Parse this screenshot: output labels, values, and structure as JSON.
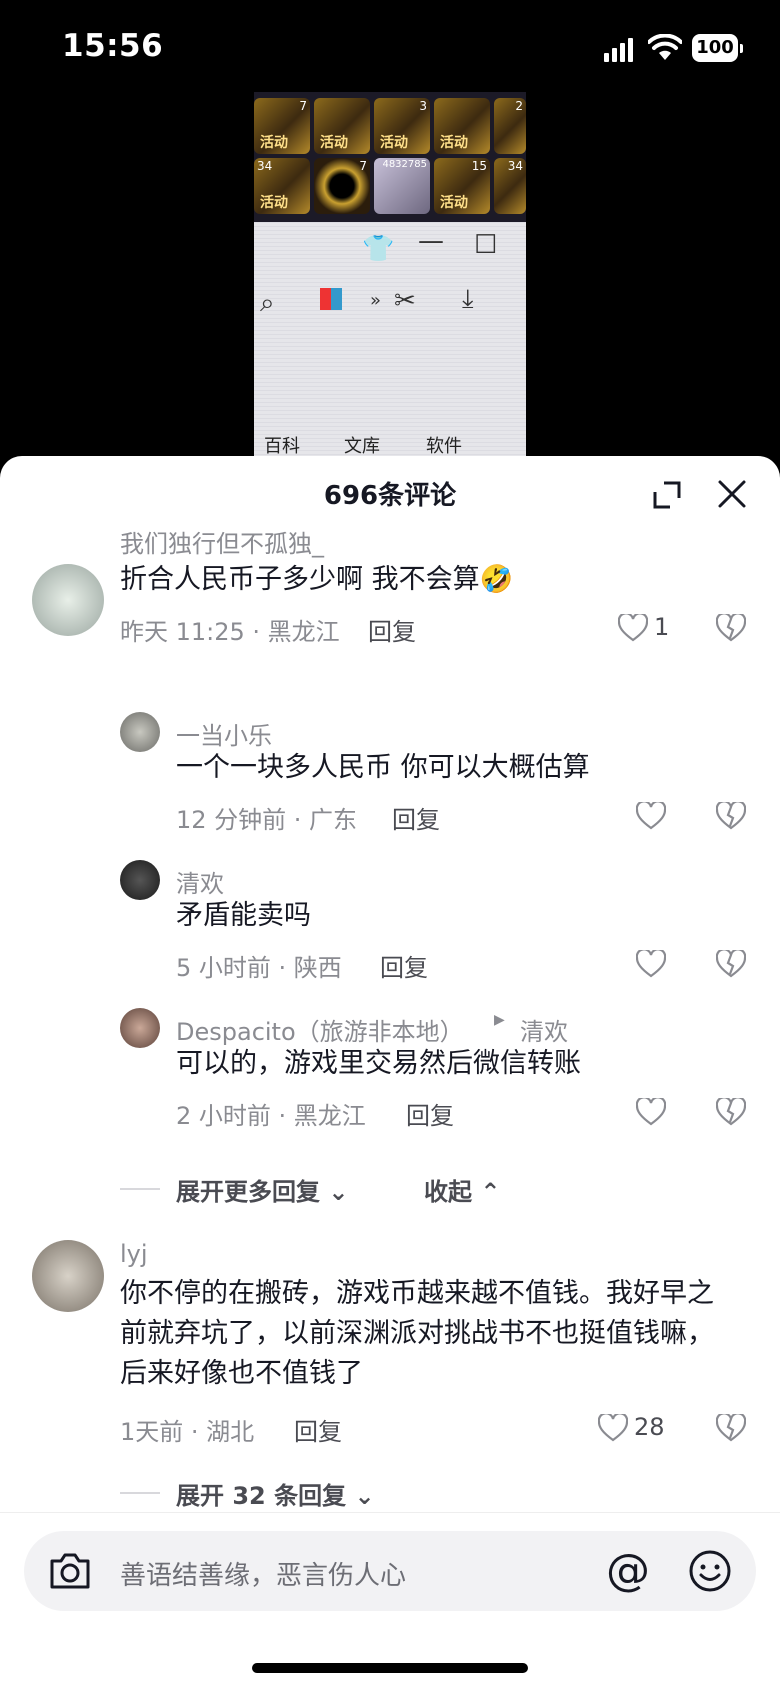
{
  "status": {
    "time": "15:56",
    "battery": "100"
  },
  "video": {
    "slots_top": [
      "7",
      "",
      "3",
      "",
      "2"
    ],
    "slots_bottom": [
      "34",
      "7",
      "4832785",
      "15",
      "34"
    ],
    "slot_label": "活动",
    "tabs": [
      "百科",
      "文库",
      "软件"
    ]
  },
  "sheet": {
    "title": "696条评论"
  },
  "comments": [
    {
      "user": "我们独行但不孤独_",
      "text": "折合人民币子多少啊 我不会算🤣",
      "meta": "昨天 11:25 · 黑龙江",
      "reply": "回复",
      "likes": "1"
    },
    {
      "user": "一当小乐",
      "text": "一个一块多人民币 你可以大概估算",
      "meta": "12 分钟前 · 广东",
      "reply": "回复"
    },
    {
      "user": "清欢",
      "text": "矛盾能卖吗",
      "meta": "5 小时前 · 陕西",
      "reply": "回复"
    },
    {
      "user": "Despacito（旅游非本地）",
      "reply_to": "清欢",
      "text": "可以的，游戏里交易然后微信转账",
      "meta": "2 小时前 · 黑龙江",
      "reply": "回复"
    },
    {
      "user": "lyj",
      "text": "你不停的在搬砖，游戏币越来越不值钱。我好早之前就弃坑了，以前深渊派对挑战书不也挺值钱嘛，后来好像也不值钱了",
      "meta": "1天前 · 湖北",
      "reply": "回复",
      "likes": "28"
    }
  ],
  "expand_more": "展开更多回复",
  "collapse": "收起",
  "expand_32": "展开 32 条回复",
  "input": {
    "placeholder": "善语结善缘，恶言伤人心"
  }
}
